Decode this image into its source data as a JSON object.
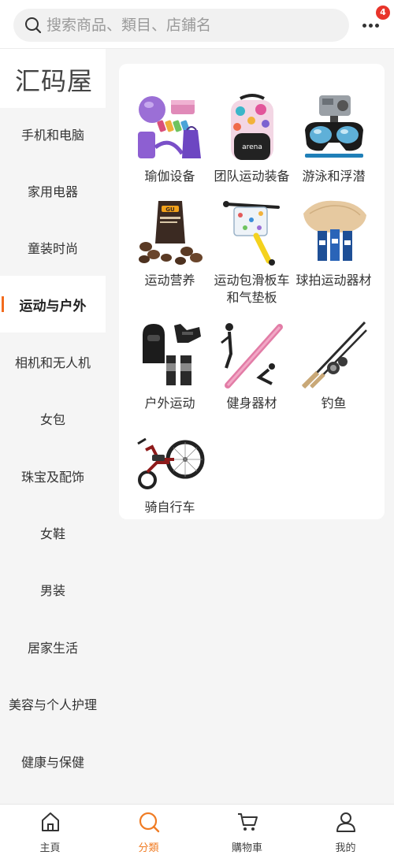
{
  "search": {
    "placeholder": "搜索商品、類目、店鋪名"
  },
  "header": {
    "more_icon": "more-dots-icon",
    "notification_count": "4"
  },
  "sidebar": {
    "brand": "汇码屋",
    "items": [
      {
        "label": "手机和电脑"
      },
      {
        "label": "家用电器"
      },
      {
        "label": "童装时尚"
      },
      {
        "label": "运动与户外",
        "active": true
      },
      {
        "label": "相机和无人机"
      },
      {
        "label": "女包"
      },
      {
        "label": "珠宝及配饰"
      },
      {
        "label": "女鞋"
      },
      {
        "label": "男装"
      },
      {
        "label": "居家生活"
      },
      {
        "label": "美容与个人护理"
      },
      {
        "label": "健康与保健"
      }
    ]
  },
  "categories": [
    {
      "label": "瑜伽设备",
      "icon": "yoga-equipment-icon"
    },
    {
      "label": "团队运动装备",
      "icon": "backpack-icon"
    },
    {
      "label": "游泳和浮潜",
      "icon": "snorkel-mask-icon"
    },
    {
      "label": "运动营养",
      "icon": "energy-gel-icon"
    },
    {
      "label": "运动包滑板车和气垫板",
      "icon": "scooter-bag-icon"
    },
    {
      "label": "球拍运动器材",
      "icon": "table-tennis-blade-icon"
    },
    {
      "label": "户外运动",
      "icon": "balaclava-gloves-icon"
    },
    {
      "label": "健身器材",
      "icon": "fitness-bar-icon"
    },
    {
      "label": "钓鱼",
      "icon": "fishing-rod-icon"
    },
    {
      "label": "骑自行车",
      "icon": "recumbent-bike-icon"
    }
  ],
  "tabbar": {
    "items": [
      {
        "label": "主頁",
        "icon": "home-icon"
      },
      {
        "label": "分類",
        "icon": "search-icon",
        "active": true
      },
      {
        "label": "購物車",
        "icon": "cart-icon"
      },
      {
        "label": "我的",
        "icon": "user-icon"
      }
    ]
  },
  "colors": {
    "accent": "#f07c24",
    "badge": "#e8342a",
    "background": "#f5f5f5"
  }
}
